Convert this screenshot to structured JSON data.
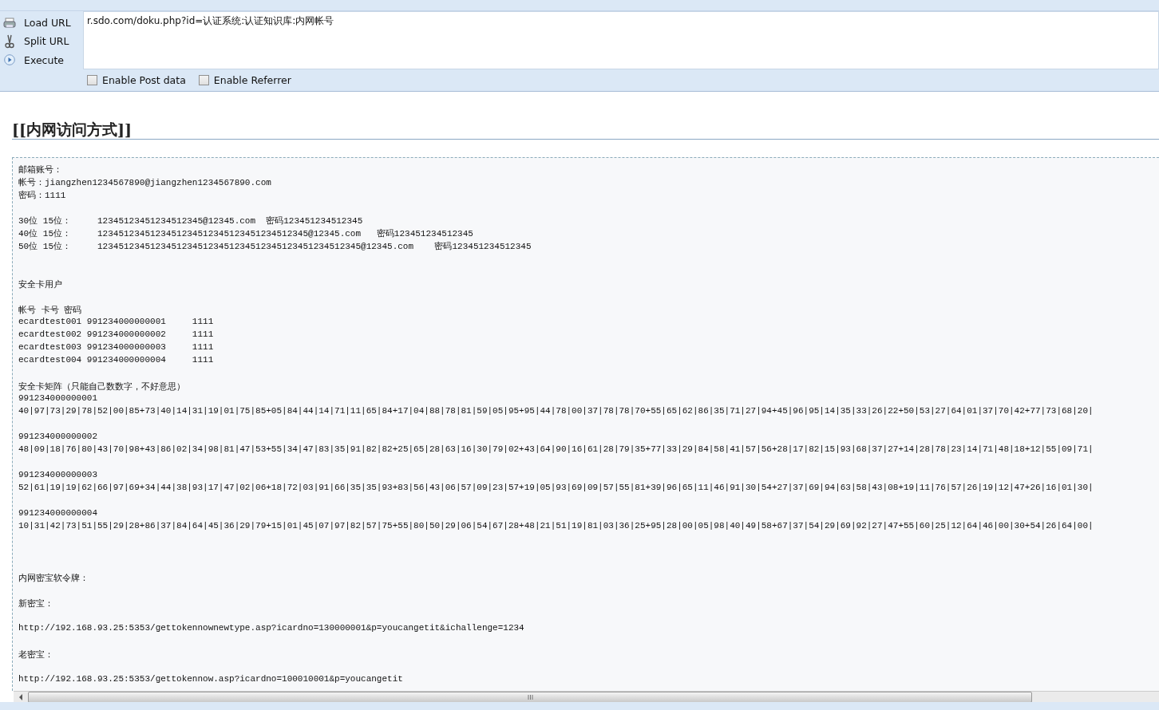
{
  "toolbar": {
    "actions": [
      {
        "kind": "load",
        "label": "Load URL"
      },
      {
        "kind": "split",
        "label": "Split URL"
      },
      {
        "kind": "execute",
        "label": "Execute"
      }
    ],
    "url": "r.sdo.com/doku.php?id=认证系统:认证知识库:内网帐号",
    "options": [
      {
        "label": "Enable Post data",
        "checked": false
      },
      {
        "label": "Enable Referrer",
        "checked": false
      }
    ]
  },
  "heading": "[[内网访问方式]]",
  "content": {
    "lines": [
      {
        "kind": "text",
        "text": "邮箱账号："
      },
      {
        "kind": "text",
        "text": "帐号：jiangzhen1234567890@jiangzhen1234567890.com"
      },
      {
        "kind": "text",
        "text": "密码：1111"
      },
      {
        "kind": "blank"
      },
      {
        "kind": "text",
        "text": "30位 15位：     12345123451234512345@12345.com  密码123451234512345"
      },
      {
        "kind": "text",
        "text": "40位 15位：     1234512345123451234512345123451234512345@12345.com   密码123451234512345"
      },
      {
        "kind": "text",
        "text": "50位 15位：     12345123451234512345123451234512345123451234512345@12345.com    密码123451234512345"
      },
      {
        "kind": "blank"
      },
      {
        "kind": "blank"
      },
      {
        "kind": "text",
        "text": "安全卡用户"
      },
      {
        "kind": "blank"
      },
      {
        "kind": "text",
        "text": "帐号 卡号 密码"
      },
      {
        "kind": "text",
        "text": "ecardtest001 991234000000001     1111"
      },
      {
        "kind": "text",
        "text": "ecardtest002 991234000000002     1111"
      },
      {
        "kind": "text",
        "text": "ecardtest003 991234000000003     1111"
      },
      {
        "kind": "text",
        "text": "ecardtest004 991234000000004     1111"
      },
      {
        "kind": "blank"
      },
      {
        "kind": "text",
        "text": "安全卡矩阵（只能自己数数字，不好意思）"
      },
      {
        "kind": "text",
        "text": "991234000000001"
      },
      {
        "kind": "text",
        "text": "40|97|73|29|78|52|00|85+73|40|14|31|19|01|75|85+05|84|44|14|71|11|65|84+17|04|88|78|81|59|05|95+95|44|78|00|37|78|78|70+55|65|62|86|35|71|27|94+45|96|95|14|35|33|26|22+50|53|27|64|01|37|70|42+77|73|68|20|"
      },
      {
        "kind": "blank"
      },
      {
        "kind": "text",
        "text": "991234000000002"
      },
      {
        "kind": "text",
        "text": "48|09|18|76|80|43|70|98+43|86|02|34|98|81|47|53+55|34|47|83|35|91|82|82+25|65|28|63|16|30|79|02+43|64|90|16|61|28|79|35+77|33|29|84|58|41|57|56+28|17|82|15|93|68|37|27+14|28|78|23|14|71|48|18+12|55|09|71|"
      },
      {
        "kind": "blank"
      },
      {
        "kind": "text",
        "text": "991234000000003"
      },
      {
        "kind": "text",
        "text": "52|61|19|19|62|66|97|69+34|44|38|93|17|47|02|06+18|72|03|91|66|35|35|93+83|56|43|06|57|09|23|57+19|05|93|69|09|57|55|81+39|96|65|11|46|91|30|54+27|37|69|94|63|58|43|08+19|11|76|57|26|19|12|47+26|16|01|30|"
      },
      {
        "kind": "blank"
      },
      {
        "kind": "text",
        "text": "991234000000004"
      },
      {
        "kind": "text",
        "text": "10|31|42|73|51|55|29|28+86|37|84|64|45|36|29|79+15|01|45|07|97|82|57|75+55|80|50|29|06|54|67|28+48|21|51|19|81|03|36|25+95|28|00|05|98|40|49|58+67|37|54|29|69|92|27|47+55|60|25|12|64|46|00|30+54|26|64|00|"
      },
      {
        "kind": "blank"
      },
      {
        "kind": "blank"
      },
      {
        "kind": "blank"
      },
      {
        "kind": "text",
        "text": "内网密宝软令牌："
      },
      {
        "kind": "blank"
      },
      {
        "kind": "text",
        "text": "新密宝："
      },
      {
        "kind": "blank"
      },
      {
        "kind": "text",
        "text": "http://192.168.93.25:5353/gettokennownewtype.asp?icardno=130000001&p=youcangetit&ichallenge=1234"
      },
      {
        "kind": "blank"
      },
      {
        "kind": "text",
        "text": "老密宝："
      },
      {
        "kind": "blank"
      },
      {
        "kind": "text",
        "text": "http://192.168.93.25:5353/gettokennow.asp?icardno=100010001&p=youcangetit"
      }
    ]
  }
}
